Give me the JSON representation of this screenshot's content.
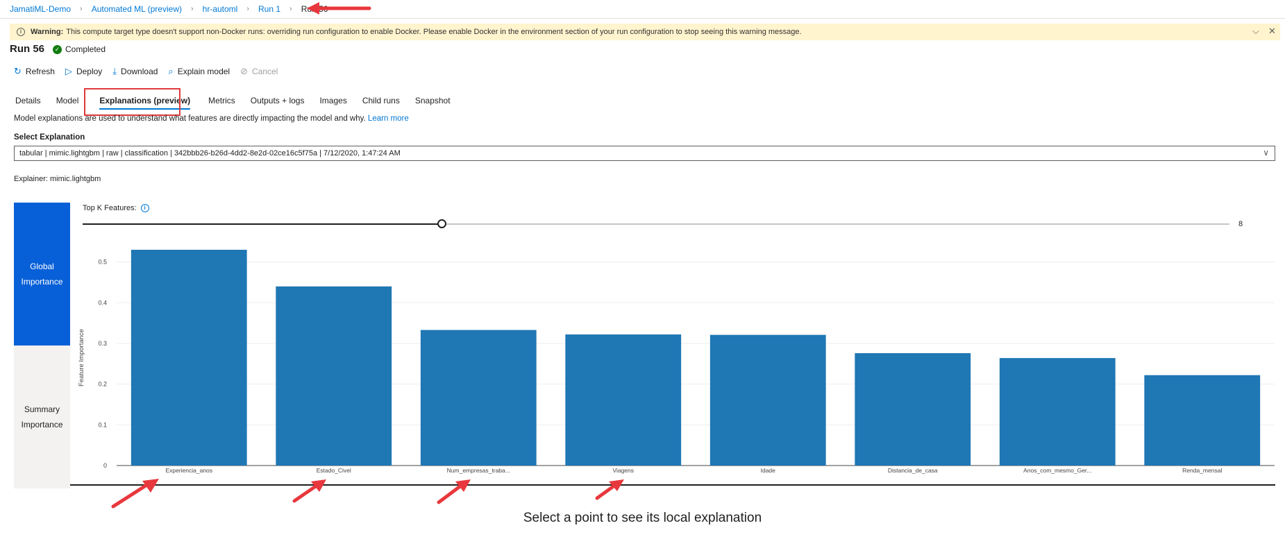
{
  "breadcrumb": [
    "JamatiML-Demo",
    "Automated ML (preview)",
    "hr-automl",
    "Run 1",
    "Run 56"
  ],
  "warning": {
    "label": "Warning:",
    "text": "This compute target type doesn't support non-Docker runs: overriding run configuration to enable Docker. Please enable Docker in the environment section of your run configuration to stop seeing this warning message."
  },
  "run": {
    "title": "Run 56",
    "status": "Completed"
  },
  "toolbar": {
    "refresh": "Refresh",
    "deploy": "Deploy",
    "download": "Download",
    "explain": "Explain model",
    "cancel": "Cancel"
  },
  "tabs": [
    "Details",
    "Model",
    "Explanations (preview)",
    "Metrics",
    "Outputs + logs",
    "Images",
    "Child runs",
    "Snapshot"
  ],
  "description": {
    "text": "Model explanations are used to understand what features are directly impacting the model and why.",
    "link": "Learn more"
  },
  "select": {
    "label": "Select Explanation",
    "value": "tabular | mimic.lightgbm | raw | classification | 342bbb26-b26d-4dd2-8e2d-02ce16c5f75a | 7/12/2020, 1:47:24 AM"
  },
  "explainer": "Explainer: mimic.lightgbm",
  "side": {
    "global_line1": "Global",
    "global_line2": "Importance",
    "summary_line1": "Summary",
    "summary_line2": "Importance"
  },
  "topk": {
    "label": "Top K Features:",
    "value": "8",
    "fraction": 0.313
  },
  "hint": "Select a point to see its local explanation",
  "colors": {
    "bar": "#1f77b4",
    "accent": "#0078d4",
    "arrow": "#e8383d"
  },
  "chart_data": {
    "type": "bar",
    "categories": [
      "Experiencia_anos",
      "Estado_Civel",
      "Num_empresas_traba...",
      "Viagens",
      "Idade",
      "Distancia_de_casa",
      "Anos_com_mesmo_Ger...",
      "Renda_mensal"
    ],
    "values": [
      0.53,
      0.44,
      0.333,
      0.322,
      0.321,
      0.276,
      0.264,
      0.222
    ],
    "ylabel": "Feature Importance",
    "yticks": [
      "0",
      "0.1",
      "0.2",
      "0.3",
      "0.4",
      "0.5"
    ],
    "ylim": [
      0,
      0.53
    ],
    "grid": true
  }
}
